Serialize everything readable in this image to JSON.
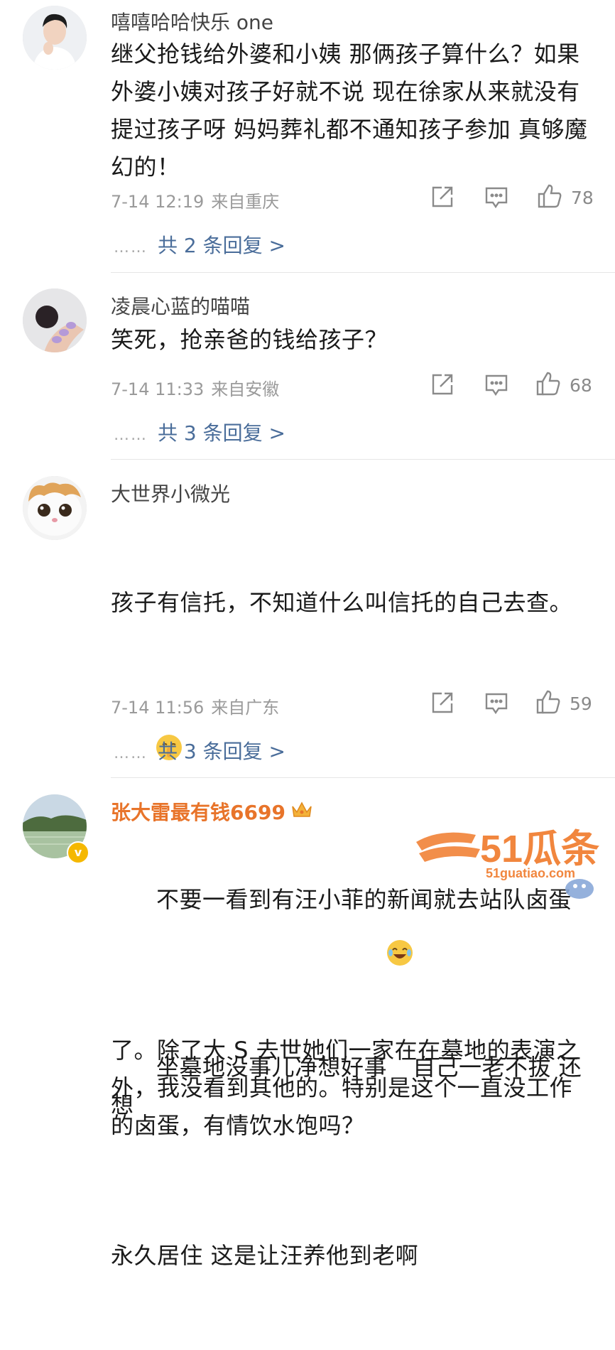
{
  "comments": [
    {
      "username": "嘻嘻哈哈快乐 one",
      "content": "继父抢钱给外婆和小姨 那俩孩子算什么？如果\n外婆小姨对孩子好就不说 现在徐家从来就没有\n提过孩子呀 妈妈葬礼都不通知孩子参加 真够魔\n幻的！",
      "time": "7-14 12:19",
      "location": "来自重庆",
      "likes": "78",
      "replies": "共 2 条回复 >"
    },
    {
      "username": "凌晨心蓝的喵喵",
      "content": "笑死，抢亲爸的钱给孩子？",
      "time": "7-14 11:33",
      "location": "来自安徽",
      "likes": "68",
      "replies": "共 3 条回复 >"
    },
    {
      "username": "大世界小微光",
      "content_line1": "孩子有信托，不知道什么叫信托的自己去查。",
      "content_line2_after_emoji": "不要一看到有汪小菲的新闻就去站队卤蛋",
      "content_rest": "了。除了大 S 去世她们一家在在墓地的表演之\n外，我没看到其他的。特别是这个一直没工作\n的卤蛋，有情饮水饱吗？",
      "time": "7-14 11:56",
      "location": "来自广东",
      "likes": "59",
      "replies": "共 3 条回复 >"
    },
    {
      "username": "张大雷最有钱6699",
      "content_line1_before_emoji": "坐墓地没事儿净想好事",
      "content_line1_after_emoji": "自己一老不拔 还想",
      "content_line2": "永久居住 这是让汪养他到老啊",
      "badge": "v"
    }
  ],
  "common": {
    "dots": "……"
  },
  "watermark": {
    "brand": "51瓜条",
    "url": "51guatiao.com"
  },
  "colors": {
    "vip_name": "#e8742a",
    "reply_link": "#4a6d9a",
    "meta_gray": "#9a9a9a",
    "badge_gold": "#f5b800"
  },
  "icons": [
    "share-icon",
    "comment-icon",
    "like-icon",
    "crown-icon",
    "emoji-shush-icon",
    "emoji-laugh-cry-icon"
  ]
}
